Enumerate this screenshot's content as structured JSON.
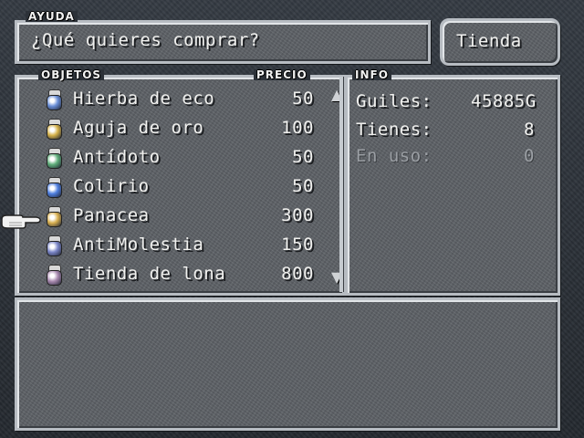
{
  "help": {
    "label": "AYUDA",
    "text": "¿Qué quieres comprar?"
  },
  "shop_button": {
    "label": "Tienda"
  },
  "items_panel": {
    "col_items": "OBJETOS",
    "col_price": "PRECIO",
    "items": [
      {
        "name": "Hierba de eco",
        "price": "50",
        "color": "#6a8fd8"
      },
      {
        "name": "Aguja de oro",
        "price": "100",
        "color": "#d6b24a"
      },
      {
        "name": "Antídoto",
        "price": "50",
        "color": "#5fae7a"
      },
      {
        "name": "Colirio",
        "price": "50",
        "color": "#4f7fe0"
      },
      {
        "name": "Panacea",
        "price": "300",
        "color": "#d9b050"
      },
      {
        "name": "AntiMolestia",
        "price": "150",
        "color": "#7b86c8"
      },
      {
        "name": "Tienda de lona",
        "price": "800",
        "color": "#a98ab0"
      }
    ],
    "selected_index": 4
  },
  "info_panel": {
    "label": "INFO",
    "gil_label": "Guiles:",
    "gil_value": "45885G",
    "have_label": "Tienes:",
    "have_value": "8",
    "equipped_label": "En uso:",
    "equipped_value": "0"
  },
  "icons": {
    "cursor": "pointing-hand-icon",
    "item": "potion-bottle-icon",
    "scroll_up": "scroll-up-arrow-icon",
    "scroll_down": "scroll-down-arrow-icon"
  }
}
